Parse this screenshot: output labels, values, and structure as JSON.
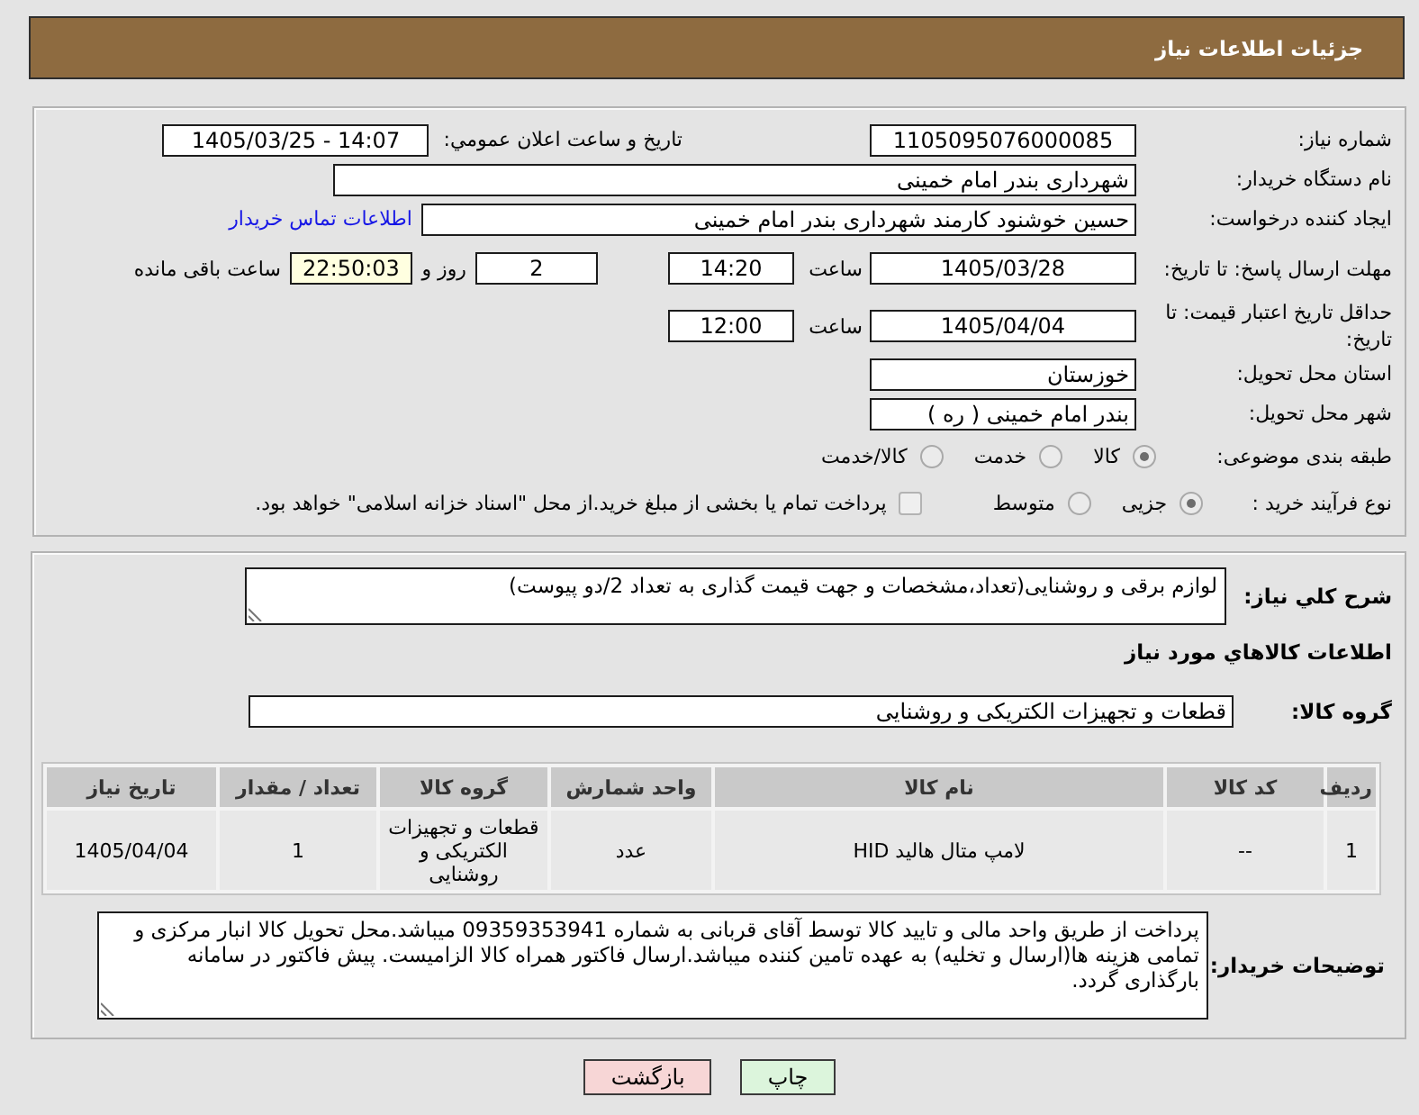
{
  "header": {
    "title": "جزئیات اطلاعات نیاز"
  },
  "details": {
    "need_number": {
      "label": "شماره نیاز:",
      "value": "1105095076000085"
    },
    "announcement": {
      "label": "تاریخ و ساعت اعلان عمومي:",
      "value": "1405/03/25 - 14:07"
    },
    "buyer": {
      "label": "نام دستگاه خریدار:",
      "value": "شهرداری بندر امام خمینی"
    },
    "requester": {
      "label": "ایجاد کننده درخواست:",
      "value": "حسین خوشنود کارمند شهرداری بندر امام خمینی",
      "contact_link": "اطلاعات تماس خریدار"
    },
    "response_deadline": {
      "label": "مهلت ارسال پاسخ: تا تاریخ:",
      "date": "1405/03/28",
      "time_label": "ساعت",
      "time": "14:20",
      "days": "2",
      "days_label": "روز و",
      "remaining": "22:50:03",
      "remaining_label": "ساعت باقی مانده"
    },
    "price_validity": {
      "label": "حداقل تاریخ اعتبار قیمت: تا تاریخ:",
      "date": "1405/04/04",
      "time_label": "ساعت",
      "time": "12:00"
    },
    "province": {
      "label": "استان محل تحویل:",
      "value": "خوزستان"
    },
    "city": {
      "label": "شهر محل تحویل:",
      "value": "بندر امام خمینی ( ره )"
    },
    "category": {
      "label": "طبقه بندی موضوعی:",
      "options": [
        {
          "label": "کالا",
          "selected": true
        },
        {
          "label": "خدمت",
          "selected": false
        },
        {
          "label": "کالا/خدمت",
          "selected": false
        }
      ]
    },
    "process": {
      "label": "نوع فرآیند خرید :",
      "options": [
        {
          "label": "جزیی",
          "selected": true
        },
        {
          "label": "متوسط",
          "selected": false
        }
      ],
      "treasury": {
        "label": "پرداخت تمام یا بخشی از مبلغ خرید.از محل \"اسناد خزانه اسلامی\" خواهد بود.",
        "checked": false
      }
    }
  },
  "need": {
    "description_label": "شرح کلي نیاز:",
    "description": "لوازم برقی و روشنایی(تعداد،مشخصات و جهت قیمت گذاری به تعداد 2/دو پیوست)",
    "goods_heading": "اطلاعات کالاهاي مورد نیاز",
    "group_label": "گروه کالا:",
    "group": "قطعات و تجهیزات الکتریکی و روشنایی",
    "table": {
      "columns": [
        "ردیف",
        "کد کالا",
        "نام کالا",
        "واحد شمارش",
        "گروه کالا",
        "تعداد / مقدار",
        "تاریخ نیاز"
      ],
      "rows": [
        [
          "1",
          "--",
          "لامپ متال هالید HID",
          "عدد",
          "قطعات و تجهیزات الکتریکی و روشنایی",
          "1",
          "1405/04/04"
        ]
      ]
    },
    "notes_label": "توضیحات خریدار:",
    "notes": "پرداخت از طریق واحد مالی و تایید کالا توسط آقای قربانی به شماره 09359353941 میباشد.محل تحویل کالا انبار مرکزی و تمامی هزینه ها(ارسال و تخلیه) به عهده تامین کننده میباشد.ارسال فاکتور همراه کالا الزامیست. پیش فاکتور در سامانه بارگذاری گردد."
  },
  "buttons": [
    {
      "label": "چاپ",
      "kind": "print"
    },
    {
      "label": "بازگشت",
      "kind": "back"
    }
  ]
}
